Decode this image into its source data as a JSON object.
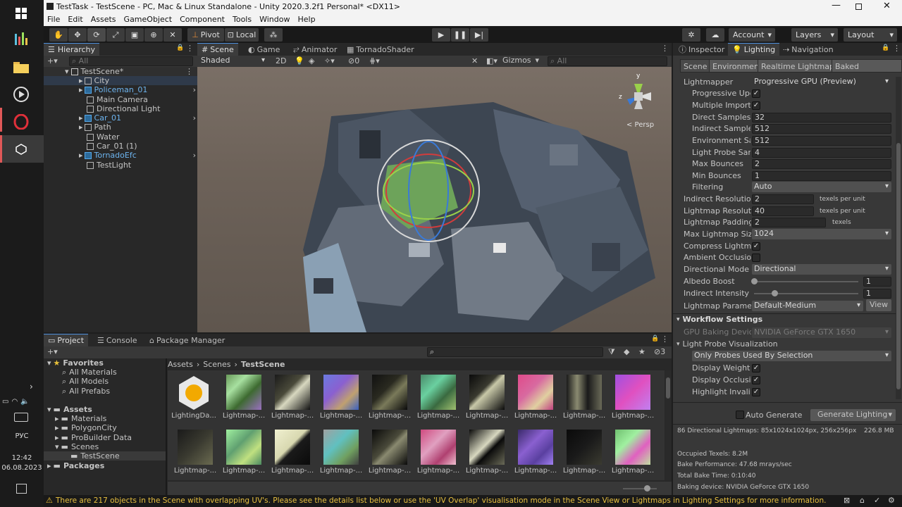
{
  "title": "TestTask - TestScene - PC, Mac & Linux Standalone - Unity 2020.3.2f1 Personal* <DX11>",
  "menu": [
    "File",
    "Edit",
    "Assets",
    "GameObject",
    "Component",
    "Tools",
    "Window",
    "Help"
  ],
  "toolbar": {
    "pivot": "Pivot",
    "local": "Local",
    "account": "Account",
    "layers": "Layers",
    "layout": "Layout"
  },
  "hierarchy": {
    "tab": "Hierarchy",
    "search_placeholder": "All",
    "scene": "TestScene*",
    "items": [
      {
        "label": "City",
        "prefab": false
      },
      {
        "label": "Policeman_01",
        "prefab": true
      },
      {
        "label": "Main Camera",
        "prefab": false
      },
      {
        "label": "Directional Light",
        "prefab": false
      },
      {
        "label": "Car_01",
        "prefab": true
      },
      {
        "label": "Path",
        "prefab": false
      },
      {
        "label": "Water",
        "prefab": false
      },
      {
        "label": "Car_01 (1)",
        "prefab": false
      },
      {
        "label": "TornadoEfc",
        "prefab": true
      },
      {
        "label": "TestLight",
        "prefab": false
      }
    ]
  },
  "scene_tabs": [
    "Scene",
    "Game",
    "Animator",
    "TornadoShader"
  ],
  "scene_bar": {
    "shading": "Shaded",
    "mode2d": "2D",
    "fx_count": "0",
    "gizmos": "Gizmos",
    "search_placeholder": "All",
    "persp": "< Persp",
    "axis_y": "y",
    "axis_z": "z"
  },
  "inspector_tabs": [
    "Inspector",
    "Lighting",
    "Navigation"
  ],
  "lighting_tabs": [
    "Scene",
    "Environment",
    "Realtime Lightmaps",
    "Baked Lightmaps"
  ],
  "lighting": {
    "lightmapper_label": "Lightmapper",
    "lightmapper": "Progressive GPU (Preview)",
    "progressive_updates": "Progressive Updates",
    "multiple_importance": "Multiple Importance Sampling",
    "direct_samples_label": "Direct Samples",
    "direct_samples": "32",
    "indirect_samples_label": "Indirect Samples",
    "indirect_samples": "512",
    "env_samples_label": "Environment Samples",
    "env_samples": "512",
    "probe_samples_label": "Light Probe Sample Multiplier",
    "probe_samples": "4",
    "max_bounces_label": "Max Bounces",
    "max_bounces": "2",
    "min_bounces_label": "Min Bounces",
    "min_bounces": "1",
    "filtering_label": "Filtering",
    "filtering": "Auto",
    "indirect_res_label": "Indirect Resolution",
    "indirect_res": "2",
    "indirect_res_unit": "texels per unit",
    "lightmap_res_label": "Lightmap Resolution",
    "lightmap_res": "40",
    "lightmap_res_unit": "texels per unit",
    "padding_label": "Lightmap Padding",
    "padding": "2",
    "padding_unit": "texels",
    "max_size_label": "Max Lightmap Size",
    "max_size": "1024",
    "compress_label": "Compress Lightmaps",
    "ao_label": "Ambient Occlusion",
    "dir_mode_label": "Directional Mode",
    "dir_mode": "Directional",
    "albedo_label": "Albedo Boost",
    "albedo": "1",
    "indirect_int_label": "Indirect Intensity",
    "indirect_int": "1",
    "params_label": "Lightmap Parameters",
    "params": "Default-Medium",
    "view": "View",
    "workflow": "Workflow Settings",
    "gpu_label": "GPU Baking Device",
    "gpu": "NVIDIA GeForce GTX 1650",
    "probe_vis": "Light Probe Visualization",
    "probe_mode": "Only Probes Used By Selection",
    "display_weights": "Display Weights",
    "display_occlusion": "Display Occlusion",
    "highlight_invalid": "Highlight Invalid Cells",
    "auto_generate": "Auto Generate",
    "generate": "Generate Lighting"
  },
  "stats": {
    "line1": "86 Directional Lightmaps: 85x1024x1024px, 256x256px",
    "size": "226.8 MB",
    "line2": "Occupied Texels: 8.2M",
    "line3": "Bake Performance: 47.68 mrays/sec",
    "line4": "Total Bake Time: 0:10:40",
    "line5": "Baking device: NVIDIA GeForce GTX 1650"
  },
  "project": {
    "tabs": [
      "Project",
      "Console",
      "Package Manager"
    ],
    "badge": "3",
    "favorites": "Favorites",
    "fav_items": [
      "All Materials",
      "All Models",
      "All Prefabs"
    ],
    "assets": "Assets",
    "asset_items": [
      "Materials",
      "PolygonCity",
      "ProBuilder Data",
      "Scenes"
    ],
    "scene_item": "TestScene",
    "packages": "Packages",
    "breadcrumb": [
      "Assets",
      "Scenes",
      "TestScene"
    ],
    "files_row1": [
      "LightingDa...",
      "Lightmap-...",
      "Lightmap-...",
      "Lightmap-...",
      "Lightmap-...",
      "Lightmap-...",
      "Lightmap-...",
      "Lightmap-...",
      "Lightmap-...",
      "Lightmap-..."
    ],
    "files_row2": [
      "Lightmap-...",
      "Lightmap-...",
      "Lightmap-...",
      "Lightmap-...",
      "Lightmap-...",
      "Lightmap-...",
      "Lightmap-...",
      "Lightmap-...",
      "Lightmap-...",
      "Lightmap-..."
    ]
  },
  "status_msg": "There are 217 objects in the Scene with overlapping UV's. Please see the details list below or use the 'UV Overlap' visualisation mode in the Scene View or Lightmaps in Lighting Settings for more information.",
  "system": {
    "lang": "РУС",
    "time": "12:42",
    "date": "06.08.2023"
  }
}
